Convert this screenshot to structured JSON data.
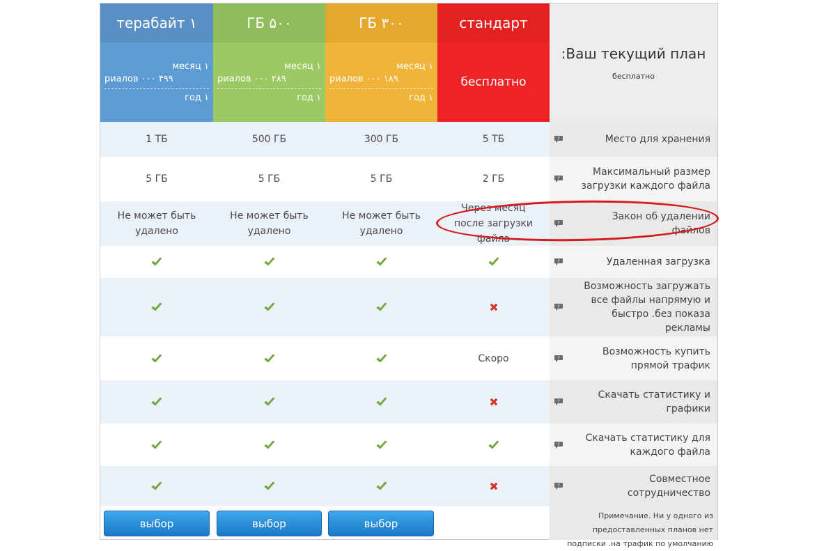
{
  "plans": [
    {
      "name": "терабайт ۱",
      "price_month": "месяц ۱",
      "price_amount": "риалов ۰۰۰ ۴۹۹",
      "price_year": "год ۱",
      "select_label": "выбор"
    },
    {
      "name": "ГБ ۵۰۰",
      "price_month": "месяц ۱",
      "price_amount": "риалов ۰۰۰ ۲۸۹",
      "price_year": "год ۱",
      "select_label": "выбор"
    },
    {
      "name": "ГБ ۳۰۰",
      "price_month": "месяц ۱",
      "price_amount": "риалов ۰۰۰ ۱۸۹",
      "price_year": "год ۱",
      "select_label": "выбор"
    },
    {
      "name": "стандарт",
      "price_label": "бесплатно"
    }
  ],
  "current_plan": {
    "title": ":Ваш текущий план",
    "value": "бесплатно"
  },
  "features": [
    {
      "label": "Место для хранения",
      "values": [
        "1 ТБ",
        "500 ГБ",
        "300 ГБ",
        "5 ТБ"
      ]
    },
    {
      "label": "Максимальный размер загрузки каждого файла",
      "values": [
        "5 ГБ",
        "5 ГБ",
        "5 ГБ",
        "2 ГБ"
      ]
    },
    {
      "label": "Закон об удалении файлов",
      "values": [
        "Не может быть удалено",
        "Не может быть удалено",
        "Не может быть удалено",
        "Через месяц после загрузки файла"
      ]
    },
    {
      "label": "Удаленная загрузка",
      "values": [
        "check",
        "check",
        "check",
        "check"
      ]
    },
    {
      "label": "Возможность загружать все файлы напрямую и быстро .без показа рекламы",
      "values": [
        "check",
        "check",
        "check",
        "cross"
      ]
    },
    {
      "label": "Возможность купить прямой трафик",
      "values": [
        "check",
        "check",
        "check",
        "Скоро"
      ]
    },
    {
      "label": "Скачать статистику и графики",
      "values": [
        "check",
        "check",
        "check",
        "cross"
      ]
    },
    {
      "label": "Скачать статистику для каждого файла",
      "values": [
        "check",
        "check",
        "check",
        "check"
      ]
    },
    {
      "label": "Совместное сотрудничество",
      "values": [
        "check",
        "check",
        "check",
        "cross"
      ]
    }
  ],
  "note": "Примечание. Ни у одного из предоставленных планов нет подписки .на трафик по умолчанию",
  "colors": {
    "blue": "#5d9bd5",
    "green": "#9cc963",
    "orange": "#f0b43a",
    "red": "#ee2424",
    "button": "#1f82d2",
    "highlight": "#d61a1a"
  },
  "icons": {
    "feature_help": "question-bubble-icon",
    "yes": "check-icon",
    "no": "cross-icon"
  }
}
